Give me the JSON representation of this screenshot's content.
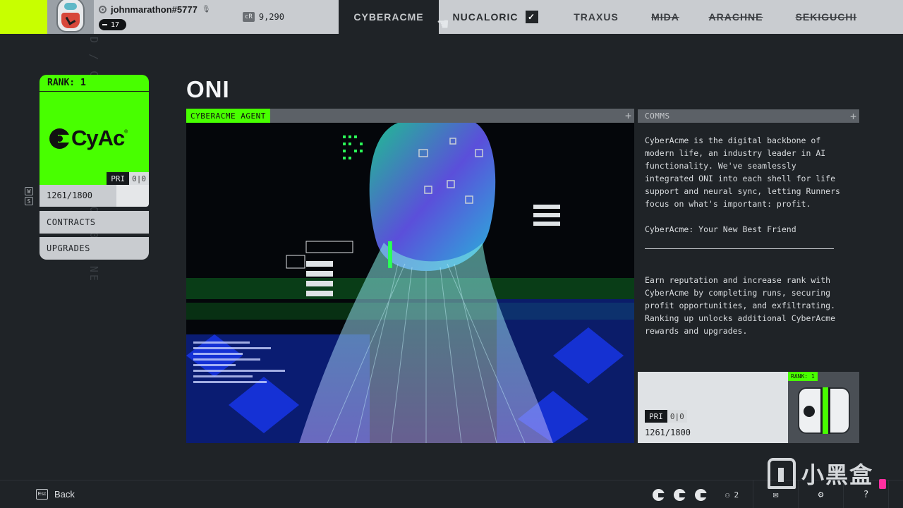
{
  "topbar": {
    "username": "johnmarathon#5777",
    "level": "17",
    "credits_badge": "cR",
    "credits": "9,290",
    "tabs": [
      {
        "label": "CYBERACME",
        "state": "active"
      },
      {
        "label": "NUCALORIC",
        "state": "completed"
      },
      {
        "label": "TRAXUS",
        "state": "available"
      },
      {
        "label": "MIDA",
        "state": "locked"
      },
      {
        "label": "ARACHNE",
        "state": "locked"
      },
      {
        "label": "SEKIGUCHI",
        "state": "locked"
      }
    ],
    "check_mark": "✓"
  },
  "side": {
    "vertical_text": "D / CONNECTED / SEASON 0 / NE",
    "keys": [
      "W",
      "S"
    ],
    "rank_label": "RANK: 1",
    "logo_text": "CyAc",
    "logo_reg": "®",
    "pri_label": "PRI",
    "pri_value": "0|0",
    "progress_text": "1261/1800",
    "progress_fraction": 0.7,
    "contracts_label": "CONTRACTS",
    "upgrades_label": "UPGRADES"
  },
  "main": {
    "title": "ONI",
    "agent_tag": "CYBERACME AGENT",
    "plus": "+"
  },
  "comms": {
    "label": "COMMS",
    "plus": "+",
    "para1": "CyberAcme is the digital backbone of modern life, an industry leader in AI functionality. We've seamlessly integrated ONI into each shell for life support and neural sync, letting Runners focus on what's important: profit.",
    "para2": "CyberAcme: Your New Best Friend",
    "para3": "Earn reputation and increase rank with CyberAcme by completing runs, securing profit opportunities, and exfiltrating. Ranking up unlocks additional CyberAcme rewards and upgrades."
  },
  "rank_footer": {
    "pri_label": "PRI",
    "pri_value": "0|0",
    "progress_text": "1261/1800",
    "reward_rank": "RANK: 1"
  },
  "bottombar": {
    "esc_key": "Esc",
    "back_label": "Back",
    "party_count": "2",
    "help": "?"
  },
  "watermark": {
    "text": "小黑盒"
  },
  "colors": {
    "accent_green": "#48ff00",
    "lime": "#c8ff00",
    "background": "#1f2327",
    "topbar": "#c9ccd0"
  }
}
